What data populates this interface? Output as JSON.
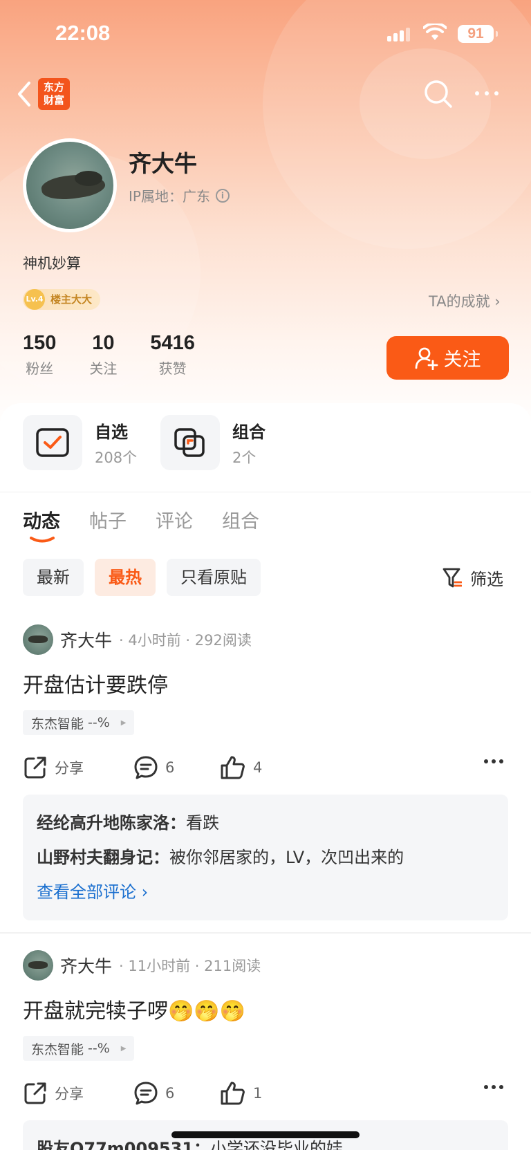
{
  "status_bar": {
    "time": "22:08",
    "battery": "91"
  },
  "nav": {
    "logo_line1": "东方",
    "logo_line2": "财富"
  },
  "profile": {
    "name": "齐大牛",
    "ip_location": "IP属地：广东",
    "bio": "神机妙算",
    "badge_level": "Lv.4",
    "badge_label": "楼主大大",
    "achievement_link": "TA的成就 ›",
    "stats": [
      {
        "value": "150",
        "label": "粉丝"
      },
      {
        "value": "10",
        "label": "关注"
      },
      {
        "value": "5416",
        "label": "获赞"
      }
    ],
    "follow_label": "关注"
  },
  "quick_links": [
    {
      "title": "自选",
      "count": "208个"
    },
    {
      "title": "组合",
      "count": "2个"
    }
  ],
  "tabs": [
    "动态",
    "帖子",
    "评论",
    "组合"
  ],
  "filters": {
    "chips": [
      "最新",
      "最热",
      "只看原贴"
    ],
    "filter_label": "筛选"
  },
  "posts": [
    {
      "author": "齐大牛",
      "meta": "· 4小时前 · 292阅读",
      "title": "开盘估计要跌停",
      "stock": "东杰智能",
      "stock_change": "--%",
      "share_label": "分享",
      "comments": "6",
      "likes": "4",
      "comment_list": [
        {
          "user": "经纶高升地陈家洛：",
          "text": "看跌"
        },
        {
          "user": "山野村夫翻身记：",
          "text": "被你邻居家的，LV，次凹出来的"
        }
      ],
      "view_all": "查看全部评论 ›"
    },
    {
      "author": "齐大牛",
      "meta": "· 11小时前 · 211阅读",
      "title": "开盘就完犊子啰🤭🤭🤭",
      "stock": "东杰智能",
      "stock_change": "--%",
      "share_label": "分享",
      "comments": "6",
      "likes": "1",
      "comment_list": [
        {
          "user": "股友Q77m009531：",
          "text": "小学还没毕业的娃"
        }
      ]
    }
  ],
  "colors": {
    "accent": "#fa5a16",
    "link": "#1a6fcf"
  }
}
